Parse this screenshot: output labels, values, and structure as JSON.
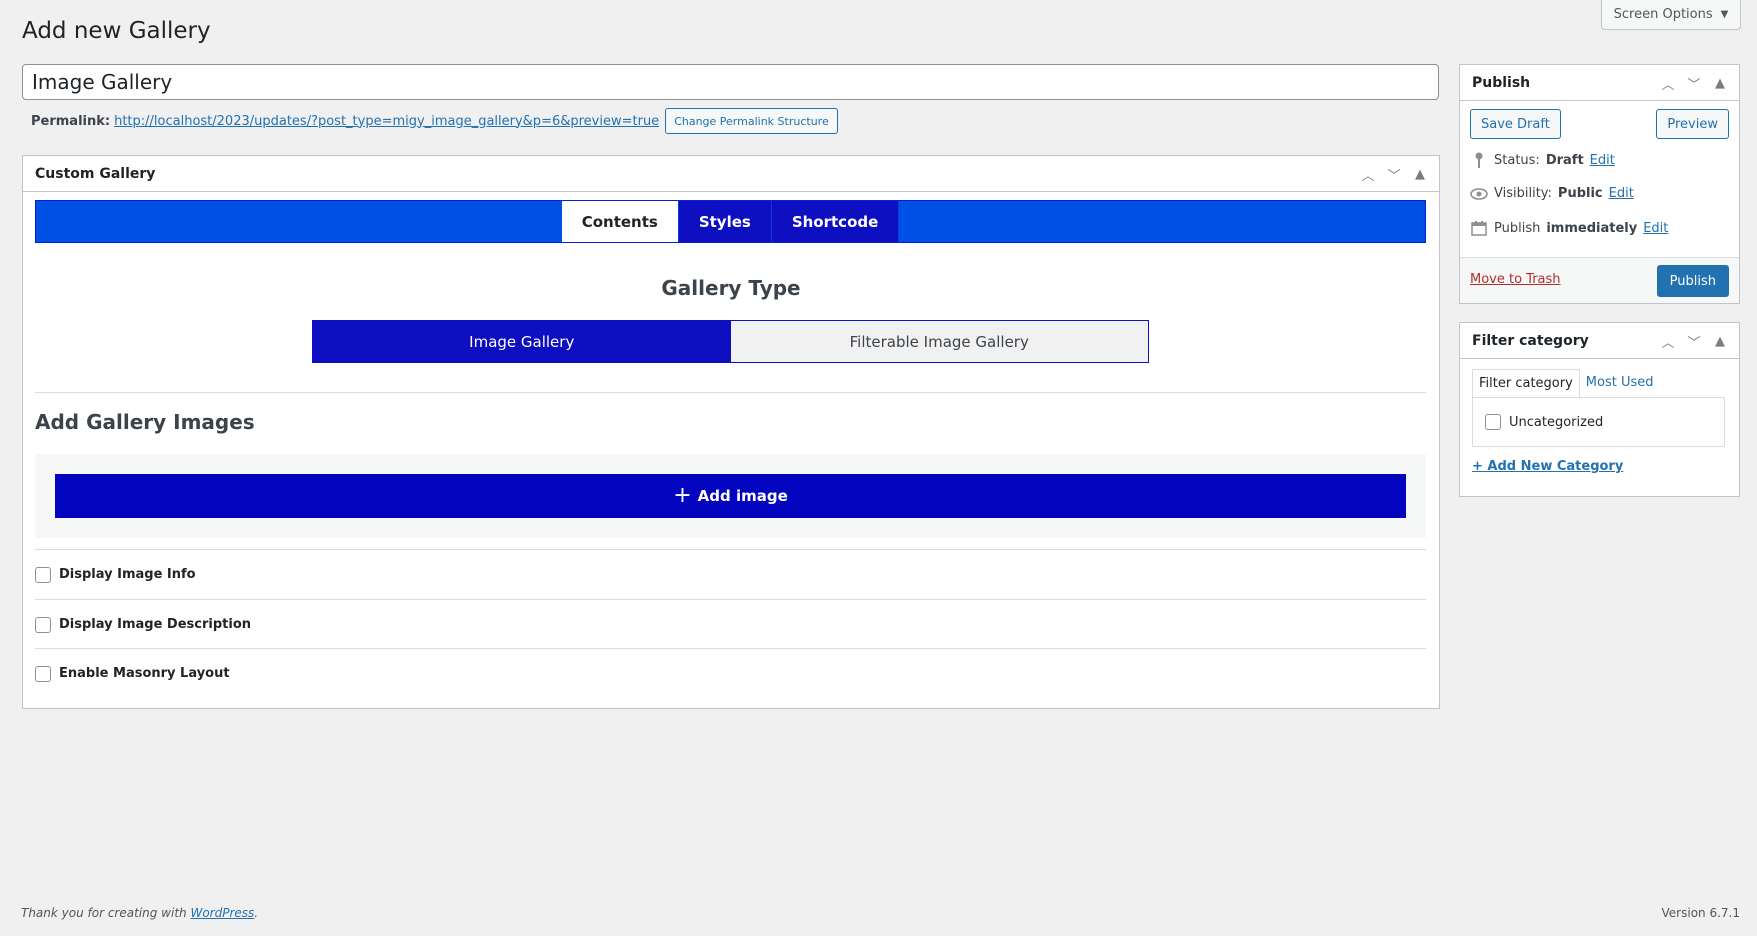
{
  "screen_options": {
    "label": "Screen Options"
  },
  "page": {
    "title": "Add new Gallery"
  },
  "post_title": {
    "value": "Image Gallery"
  },
  "permalink": {
    "label": "Permalink:",
    "url": "http://localhost/2023/updates/?post_type=migy_image_gallery&p=6&preview=true",
    "change_button": "Change Permalink Structure"
  },
  "custom_gallery": {
    "title": "Custom Gallery",
    "tabs": [
      "Contents",
      "Styles",
      "Shortcode"
    ],
    "active_tab": "Contents",
    "gallery_type_title": "Gallery Type",
    "gallery_types": [
      "Image Gallery",
      "Filterable Image Gallery"
    ],
    "selected_type": "Image Gallery",
    "add_images_title": "Add Gallery Images",
    "add_image_button": "Add image",
    "options": [
      {
        "label": "Display Image Info",
        "checked": false
      },
      {
        "label": "Display Image Description",
        "checked": false
      },
      {
        "label": "Enable Masonry Layout",
        "checked": false
      }
    ]
  },
  "publish": {
    "title": "Publish",
    "save_draft": "Save Draft",
    "preview": "Preview",
    "status_label": "Status:",
    "status_value": "Draft",
    "visibility_label": "Visibility:",
    "visibility_value": "Public",
    "publish_label": "Publish",
    "publish_value": "immediately",
    "edit": "Edit",
    "move_to_trash": "Move to Trash",
    "publish_button": "Publish"
  },
  "filter_category": {
    "title": "Filter category",
    "tabs": [
      "Filter category",
      "Most Used"
    ],
    "categories": [
      {
        "label": "Uncategorized",
        "checked": false
      }
    ],
    "add_new": "+ Add New Category"
  },
  "footer": {
    "thanks_prefix": "Thank you for creating with",
    "wordpress_link": "WordPress",
    "thanks_suffix": ".",
    "version": "Version 6.7.1"
  },
  "colors": {
    "tabbar_bg": "#0050e6",
    "tab_bg": "#0d0fc0",
    "add_image_bg": "#0305bf",
    "wp_blue": "#2271b1",
    "trash_red": "#b32d2e"
  }
}
